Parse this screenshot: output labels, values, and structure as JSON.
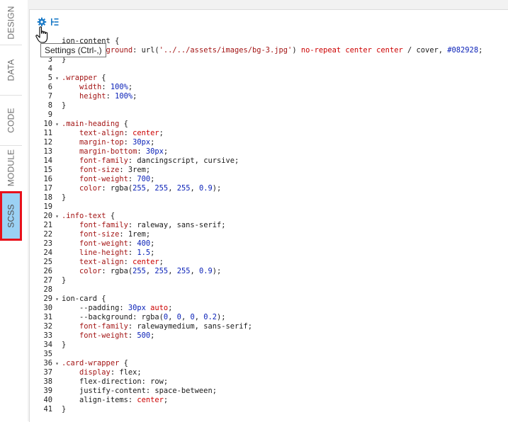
{
  "side_tabs": [
    {
      "label": "DESIGN",
      "active": false
    },
    {
      "label": "DATA",
      "active": false
    },
    {
      "label": "CODE",
      "active": false
    },
    {
      "label": "MODULE",
      "active": false
    },
    {
      "label": "SCSS",
      "active": true
    }
  ],
  "toolbar": {
    "settings_icon": "gear-icon",
    "outline_icon": "outline-icon",
    "tooltip": "Settings (Ctrl-,)"
  },
  "colors": {
    "active_tab": "#9bd1f4",
    "highlight_border": "#e8101b",
    "number": "#0b22b8",
    "property": "#a31515",
    "keyword": "#cc0000"
  },
  "code_lines": [
    {
      "n": "",
      "f": "",
      "t": [
        [
          "sel",
          "ion-content {"
        ]
      ]
    },
    {
      "n": "",
      "f": "",
      "t": [
        [
          "prop",
          "    --background"
        ],
        [
          "plain",
          ": "
        ],
        [
          "plain",
          "url("
        ],
        [
          "str",
          "'../../assets/images/bg-3.jpg'"
        ],
        [
          "plain",
          ") "
        ],
        [
          "kw",
          "no-repeat center center"
        ],
        [
          "plain",
          " / cover, "
        ],
        [
          "num",
          "#082928"
        ],
        [
          "plain",
          ";"
        ]
      ]
    },
    {
      "n": "3",
      "f": "",
      "t": [
        [
          "plain",
          "}"
        ]
      ]
    },
    {
      "n": "4",
      "f": "",
      "t": []
    },
    {
      "n": "5",
      "f": "▾",
      "t": [
        [
          "prop",
          ".wrapper"
        ],
        [
          "plain",
          " {"
        ]
      ]
    },
    {
      "n": "6",
      "f": "",
      "t": [
        [
          "prop",
          "    width"
        ],
        [
          "plain",
          ": "
        ],
        [
          "num",
          "100%"
        ],
        [
          "plain",
          ";"
        ]
      ]
    },
    {
      "n": "7",
      "f": "",
      "t": [
        [
          "prop",
          "    height"
        ],
        [
          "plain",
          ": "
        ],
        [
          "num",
          "100%"
        ],
        [
          "plain",
          ";"
        ]
      ]
    },
    {
      "n": "8",
      "f": "",
      "t": [
        [
          "plain",
          "}"
        ]
      ]
    },
    {
      "n": "9",
      "f": "",
      "t": []
    },
    {
      "n": "10",
      "f": "▾",
      "t": [
        [
          "prop",
          ".main-heading"
        ],
        [
          "plain",
          " {"
        ]
      ]
    },
    {
      "n": "11",
      "f": "",
      "t": [
        [
          "prop",
          "    text-align"
        ],
        [
          "plain",
          ": "
        ],
        [
          "kw",
          "center"
        ],
        [
          "plain",
          ";"
        ]
      ]
    },
    {
      "n": "12",
      "f": "",
      "t": [
        [
          "prop",
          "    margin-top"
        ],
        [
          "plain",
          ": "
        ],
        [
          "num",
          "30px"
        ],
        [
          "plain",
          ";"
        ]
      ]
    },
    {
      "n": "13",
      "f": "",
      "t": [
        [
          "prop",
          "    margin-bottom"
        ],
        [
          "plain",
          ": "
        ],
        [
          "num",
          "30px"
        ],
        [
          "plain",
          ";"
        ]
      ]
    },
    {
      "n": "14",
      "f": "",
      "t": [
        [
          "prop",
          "    font-family"
        ],
        [
          "plain",
          ": dancingscript, cursive;"
        ]
      ]
    },
    {
      "n": "15",
      "f": "",
      "t": [
        [
          "prop",
          "    font-size"
        ],
        [
          "plain",
          ": "
        ],
        [
          "plain",
          "3rem"
        ],
        [
          "plain",
          ";"
        ]
      ]
    },
    {
      "n": "16",
      "f": "",
      "t": [
        [
          "prop",
          "    font-weight"
        ],
        [
          "plain",
          ": "
        ],
        [
          "num",
          "700"
        ],
        [
          "plain",
          ";"
        ]
      ]
    },
    {
      "n": "17",
      "f": "",
      "t": [
        [
          "prop",
          "    color"
        ],
        [
          "plain",
          ": rgba("
        ],
        [
          "num",
          "255"
        ],
        [
          "plain",
          ", "
        ],
        [
          "num",
          "255"
        ],
        [
          "plain",
          ", "
        ],
        [
          "num",
          "255"
        ],
        [
          "plain",
          ", "
        ],
        [
          "num",
          "0.9"
        ],
        [
          "plain",
          ");"
        ]
      ]
    },
    {
      "n": "18",
      "f": "",
      "t": [
        [
          "plain",
          "}"
        ]
      ]
    },
    {
      "n": "19",
      "f": "",
      "t": []
    },
    {
      "n": "20",
      "f": "▾",
      "t": [
        [
          "prop",
          ".info-text"
        ],
        [
          "plain",
          " {"
        ]
      ]
    },
    {
      "n": "21",
      "f": "",
      "t": [
        [
          "prop",
          "    font-family"
        ],
        [
          "plain",
          ": raleway, sans-serif;"
        ]
      ]
    },
    {
      "n": "22",
      "f": "",
      "t": [
        [
          "prop",
          "    font-size"
        ],
        [
          "plain",
          ": "
        ],
        [
          "plain",
          "1rem"
        ],
        [
          "plain",
          ";"
        ]
      ]
    },
    {
      "n": "23",
      "f": "",
      "t": [
        [
          "prop",
          "    font-weight"
        ],
        [
          "plain",
          ": "
        ],
        [
          "num",
          "400"
        ],
        [
          "plain",
          ";"
        ]
      ]
    },
    {
      "n": "24",
      "f": "",
      "t": [
        [
          "prop",
          "    line-height"
        ],
        [
          "plain",
          ": "
        ],
        [
          "num",
          "1.5"
        ],
        [
          "plain",
          ";"
        ]
      ]
    },
    {
      "n": "25",
      "f": "",
      "t": [
        [
          "prop",
          "    text-align"
        ],
        [
          "plain",
          ": "
        ],
        [
          "kw",
          "center"
        ],
        [
          "plain",
          ";"
        ]
      ]
    },
    {
      "n": "26",
      "f": "",
      "t": [
        [
          "prop",
          "    color"
        ],
        [
          "plain",
          ": rgba("
        ],
        [
          "num",
          "255"
        ],
        [
          "plain",
          ", "
        ],
        [
          "num",
          "255"
        ],
        [
          "plain",
          ", "
        ],
        [
          "num",
          "255"
        ],
        [
          "plain",
          ", "
        ],
        [
          "num",
          "0.9"
        ],
        [
          "plain",
          ");"
        ]
      ]
    },
    {
      "n": "27",
      "f": "",
      "t": [
        [
          "plain",
          "}"
        ]
      ]
    },
    {
      "n": "28",
      "f": "",
      "t": []
    },
    {
      "n": "29",
      "f": "▾",
      "t": [
        [
          "sel",
          "ion-card"
        ],
        [
          "plain",
          " {"
        ]
      ]
    },
    {
      "n": "30",
      "f": "",
      "t": [
        [
          "plain",
          "    --padding: "
        ],
        [
          "num",
          "30px"
        ],
        [
          "plain",
          " "
        ],
        [
          "kw",
          "auto"
        ],
        [
          "plain",
          ";"
        ]
      ]
    },
    {
      "n": "31",
      "f": "",
      "t": [
        [
          "plain",
          "    --background: rgba("
        ],
        [
          "num",
          "0"
        ],
        [
          "plain",
          ", "
        ],
        [
          "num",
          "0"
        ],
        [
          "plain",
          ", "
        ],
        [
          "num",
          "0"
        ],
        [
          "plain",
          ", "
        ],
        [
          "num",
          "0.2"
        ],
        [
          "plain",
          ");"
        ]
      ]
    },
    {
      "n": "32",
      "f": "",
      "t": [
        [
          "prop",
          "    font-family"
        ],
        [
          "plain",
          ": ralewaymedium, sans-serif;"
        ]
      ]
    },
    {
      "n": "33",
      "f": "",
      "t": [
        [
          "prop",
          "    font-weight"
        ],
        [
          "plain",
          ": "
        ],
        [
          "num",
          "500"
        ],
        [
          "plain",
          ";"
        ]
      ]
    },
    {
      "n": "34",
      "f": "",
      "t": [
        [
          "plain",
          "}"
        ]
      ]
    },
    {
      "n": "35",
      "f": "",
      "t": []
    },
    {
      "n": "36",
      "f": "▾",
      "t": [
        [
          "prop",
          ".card-wrapper"
        ],
        [
          "plain",
          " {"
        ]
      ]
    },
    {
      "n": "37",
      "f": "",
      "t": [
        [
          "prop",
          "    display"
        ],
        [
          "plain",
          ": flex;"
        ]
      ]
    },
    {
      "n": "38",
      "f": "",
      "t": [
        [
          "plain",
          "    flex-direction: row;"
        ]
      ]
    },
    {
      "n": "39",
      "f": "",
      "t": [
        [
          "plain",
          "    justify-content: space-between;"
        ]
      ]
    },
    {
      "n": "40",
      "f": "",
      "t": [
        [
          "plain",
          "    align-items: "
        ],
        [
          "kw",
          "center"
        ],
        [
          "plain",
          ";"
        ]
      ]
    },
    {
      "n": "41",
      "f": "",
      "t": [
        [
          "plain",
          "}"
        ]
      ]
    }
  ]
}
